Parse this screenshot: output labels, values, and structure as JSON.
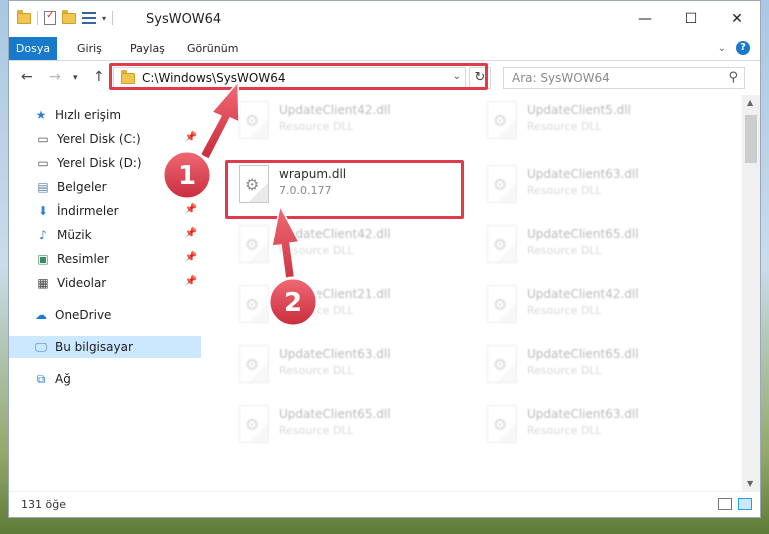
{
  "window": {
    "title": "SysWOW64"
  },
  "ribbon": {
    "tabs": [
      "Dosya",
      "Giriş",
      "Paylaş",
      "Görünüm"
    ]
  },
  "addressbar": {
    "path": "C:\\Windows\\SysWOW64",
    "search_placeholder": "Ara: SysWOW64"
  },
  "nav": {
    "items": [
      {
        "label": "Hızlı erişim",
        "icon": "star-icon",
        "pinned": false
      },
      {
        "label": "Yerel Disk (C:)",
        "icon": "drive-icon",
        "pinned": true
      },
      {
        "label": "Yerel Disk (D:)",
        "icon": "drive-icon",
        "pinned": false
      },
      {
        "label": "Belgeler",
        "icon": "documents-icon",
        "pinned": true
      },
      {
        "label": "İndirmeler",
        "icon": "download-icon",
        "pinned": true
      },
      {
        "label": "Müzik",
        "icon": "music-icon",
        "pinned": true
      },
      {
        "label": "Resimler",
        "icon": "pictures-icon",
        "pinned": true
      },
      {
        "label": "Videolar",
        "icon": "video-icon",
        "pinned": true
      },
      {
        "label": "OneDrive",
        "icon": "cloud-icon",
        "pinned": false
      },
      {
        "label": "Bu bilgisayar",
        "icon": "computer-icon",
        "pinned": false
      },
      {
        "label": "Ağ",
        "icon": "network-icon",
        "pinned": false
      }
    ]
  },
  "files": {
    "left": [
      {
        "name": "UpdateClient42.dll",
        "desc": "Resource DLL"
      },
      {
        "name": "wrapum.dll",
        "desc": "7.0.0.177"
      },
      {
        "name": "UpdateClient42.dll",
        "desc": "Resource DLL"
      },
      {
        "name": "UpdateClient21.dll",
        "desc": "Resource DLL"
      },
      {
        "name": "UpdateClient63.dll",
        "desc": "Resource DLL"
      },
      {
        "name": "UpdateClient65.dll",
        "desc": "Resource DLL"
      }
    ],
    "right": [
      {
        "name": "UpdateClient5.dll",
        "desc": "Resource DLL"
      },
      {
        "name": "UpdateClient63.dll",
        "desc": "Resource DLL"
      },
      {
        "name": "UpdateClient65.dll",
        "desc": "Resource DLL"
      },
      {
        "name": "UpdateClient42.dll",
        "desc": "Resource DLL"
      },
      {
        "name": "UpdateClient65.dll",
        "desc": "Resource DLL"
      },
      {
        "name": "UpdateClient63.dll",
        "desc": "Resource DLL"
      }
    ]
  },
  "status": {
    "count": "131 öğe"
  },
  "annotations": {
    "step1": "1",
    "step2": "2",
    "color": "#e03b4a"
  }
}
